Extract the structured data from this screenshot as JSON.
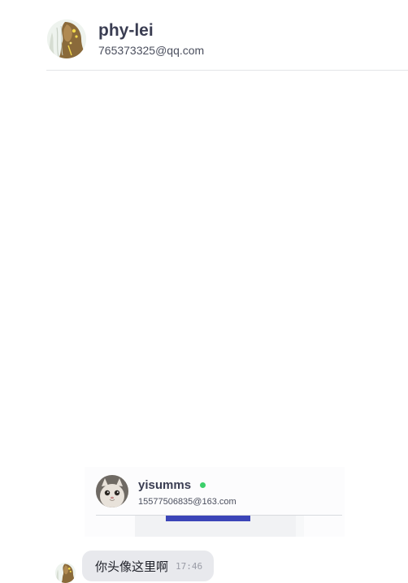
{
  "chat_header": {
    "name": "phy-lei",
    "email": "765373325@qq.com",
    "avatar_icon": "user-avatar-illustration"
  },
  "messages": [
    {
      "type": "image",
      "card": {
        "name": "yisumms",
        "email": "15577506835@163.com",
        "online": true,
        "online_color": "#3ccf6a",
        "avatar_icon": "cat-avatar"
      }
    },
    {
      "type": "text",
      "text": "你头像这里啊",
      "time": "17:46",
      "avatar_icon": "user-avatar-illustration"
    }
  ],
  "colors": {
    "bubble": "#e8e9ed",
    "name": "#3a3d52",
    "accent_blue": "#3b45b8"
  }
}
